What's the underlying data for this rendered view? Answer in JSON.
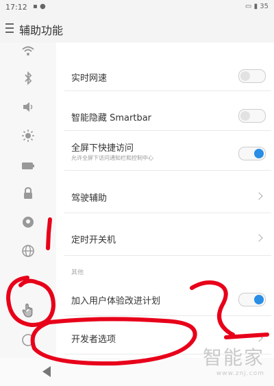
{
  "status_bar": {
    "time": "17:12",
    "battery": "35"
  },
  "header": {
    "title": "辅助功能",
    "menu_icon": "menu-icon"
  },
  "sidebar": {
    "icons": [
      "wifi-icon",
      "bluetooth-icon",
      "volume-icon",
      "brightness-icon",
      "battery-icon",
      "lock-icon",
      "privacy-icon",
      "globe-icon",
      "hand-icon",
      "info-icon"
    ]
  },
  "settings": {
    "realtime_speed": {
      "label": "实时网速",
      "enabled": false
    },
    "smart_hide": {
      "label": "智能隐藏 Smartbar",
      "enabled": false
    },
    "fullscreen_quick": {
      "label": "全屏下快捷访问",
      "subtitle": "允许全屏下访问通知栏和控制中心",
      "enabled": true
    },
    "driving_assist": {
      "label": "驾驶辅助"
    },
    "scheduled_power": {
      "label": "定时开关机"
    },
    "section_other": "其他",
    "user_experience": {
      "label": "加入用户体验改进计划",
      "enabled": true
    },
    "developer_options": {
      "label": "开发者选项"
    }
  },
  "watermark": {
    "logo": "智能家",
    "url": "www.znj.com"
  },
  "colors": {
    "accent": "#2a8ee6",
    "annotation": "#e8001a"
  }
}
